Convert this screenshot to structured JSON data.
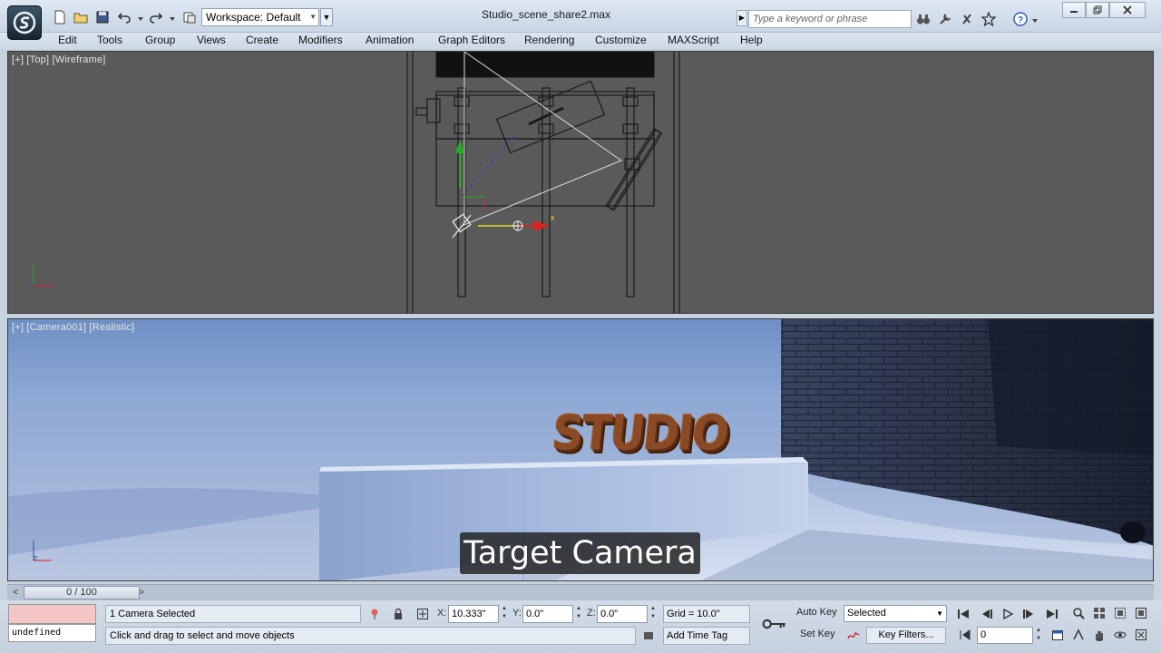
{
  "titlebar": {
    "workspace_label": "Workspace: Default",
    "document_title": "Studio_scene_share2.max",
    "search_placeholder": "Type a keyword or phrase"
  },
  "menu": {
    "items": [
      "Edit",
      "Tools",
      "Group",
      "Views",
      "Create",
      "Modifiers",
      "Animation",
      "Graph Editors",
      "Rendering",
      "Customize",
      "MAXScript",
      "Help"
    ]
  },
  "viewports": {
    "top": {
      "label": "[+] [Top] [Wireframe]",
      "axis_x": "x"
    },
    "camera": {
      "label": "[+] [Camera001] [Realistic]",
      "scene_text": "STUDIO",
      "axis_z": "z"
    }
  },
  "subtitle": "Target Camera",
  "timeslider": {
    "frame_label": "0 / 100",
    "prev": "<",
    "next": ">"
  },
  "status": {
    "maxscript_value": "undefined",
    "selection": "1 Camera Selected",
    "prompt": "Click and drag to select and move objects",
    "x_label": "X:",
    "x_value": "10.333\"",
    "y_label": "Y:",
    "y_value": "0.0\"",
    "z_label": "Z:",
    "z_value": "0.0\"",
    "grid": "Grid = 10.0\"",
    "add_time_tag": "Add Time Tag",
    "auto_key": "Auto Key",
    "set_key": "Set Key",
    "key_mode": "Selected",
    "key_filters": "Key Filters...",
    "current_frame": "0"
  },
  "colors": {
    "viewport_bg": "#5a5a5a",
    "subtitle_bg": "#1e1e1e",
    "studio_text": "#8a4a25",
    "axis_x": "#e02020",
    "axis_y": "#20b020",
    "gizmo_yellow": "#e8e020"
  }
}
